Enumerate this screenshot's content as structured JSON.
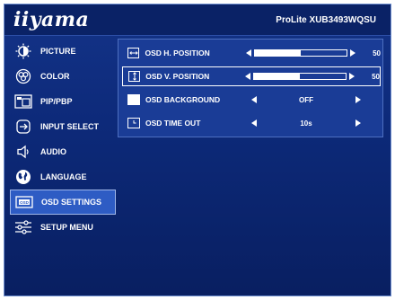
{
  "header": {
    "logo": "iiyama",
    "model": "ProLite XUB3493WQSU"
  },
  "menu": {
    "items": [
      {
        "label": "PICTURE",
        "icon": "brightness-icon"
      },
      {
        "label": "COLOR",
        "icon": "color-palette-icon"
      },
      {
        "label": "PIP/PBP",
        "icon": "pip-icon"
      },
      {
        "label": "INPUT SELECT",
        "icon": "input-select-icon"
      },
      {
        "label": "AUDIO",
        "icon": "speaker-icon"
      },
      {
        "label": "LANGUAGE",
        "icon": "globe-icon"
      },
      {
        "label": "OSD SETTINGS",
        "icon": "osd-icon",
        "active": true
      },
      {
        "label": "SETUP MENU",
        "icon": "sliders-icon"
      }
    ]
  },
  "osd_settings": {
    "h_position": {
      "label": "OSD H. POSITION",
      "value": "50",
      "level": 0.5
    },
    "v_position": {
      "label": "OSD V. POSITION",
      "value": "50",
      "level": 0.5,
      "selected": true
    },
    "background": {
      "label": "OSD BACKGROUND",
      "value": "OFF"
    },
    "time_out": {
      "label": "OSD TIME OUT",
      "value": "10s"
    }
  },
  "colors": {
    "background": "#0d2a7a",
    "panel": "#1a3c96",
    "active_item": "#2e5cc4",
    "text": "#ffffff"
  }
}
